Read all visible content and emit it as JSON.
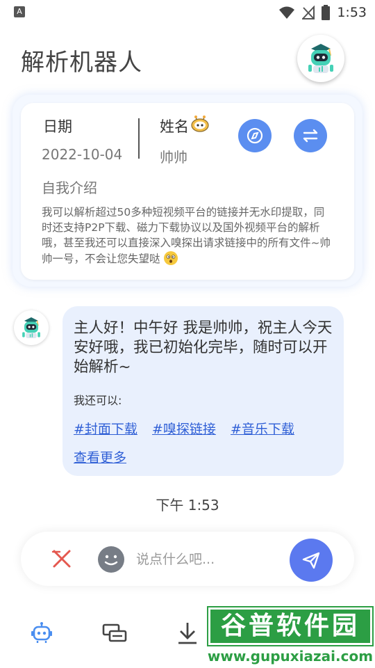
{
  "status_bar": {
    "left_icon": "A",
    "time": "1:53",
    "icons": [
      "wifi-icon",
      "no-signal-icon",
      "battery-icon"
    ]
  },
  "app": {
    "title": "解析机器人"
  },
  "profile": {
    "date_label": "日期",
    "date_value": "2022-10-04",
    "name_label": "姓名",
    "name_value": "帅帅",
    "intro_label": "自我介绍",
    "intro_text": "我可以解析超过50多种短视频平台的链接并无水印提取，同时还支持P2P下载、磁力下载协议以及国外视频平台的解析哦，甚至我还可以直接深入嗅探出请求链接中的所有文件~帅帅一号，不会让您失望哒"
  },
  "chat": {
    "message": "主人好！中午好 我是帅帅，祝主人今天安好哦，我已初始化完毕，随时可以开始解析~",
    "sub_label": "我还可以:",
    "tags": [
      "#封面下载",
      "#嗅探链接",
      "#音乐下载"
    ],
    "more_link": "查看更多",
    "timestamp": "下午 1:53"
  },
  "input": {
    "placeholder": "说点什么吧..."
  },
  "nav": {
    "items": [
      "robot-icon",
      "cards-icon",
      "download-icon"
    ]
  },
  "watermark": {
    "title": "谷普软件园",
    "url": "www.gupuxiazai.com"
  },
  "colors": {
    "accent": "#5b8ef0",
    "send": "#5b79ef",
    "link": "#2f5fd6",
    "bubble": "#e9f0fd",
    "watermark": "#2c9e44"
  }
}
